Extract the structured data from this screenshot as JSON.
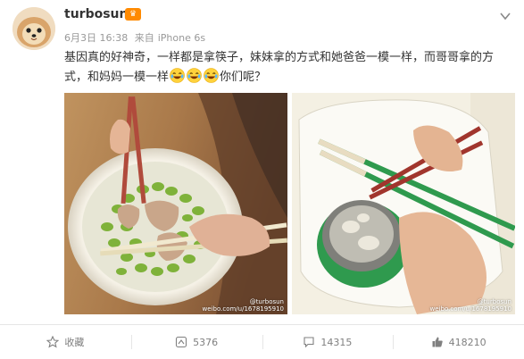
{
  "post": {
    "username": "turbosun",
    "date": "6月3日 16:38",
    "source_prefix": "来自",
    "source_device": "iPhone 6s",
    "text_main": "基因真的好神奇，一样都是拿筷子，妹妹拿的方式和她爸爸一模一样，而哥哥拿的方式，和妈妈一模一样",
    "text_tail": "你们呢？",
    "emoji_name": "laughing-crying-emoji",
    "watermark_handle": "@turbosun",
    "watermark_url": "weibo.com/u/1678195910"
  },
  "actions": {
    "favorite_label": "收藏",
    "repost_count": "5376",
    "comment_count": "14315",
    "like_count": "418210"
  },
  "colors": {
    "accent_orange": "#ff8a00",
    "text_dark": "#333333",
    "text_gray": "#999999",
    "footer_gray": "#808080"
  },
  "icons": [
    "vip-badge-icon",
    "chevron-down-icon",
    "star-icon",
    "repost-icon",
    "comment-icon",
    "thumbs-up-icon"
  ]
}
